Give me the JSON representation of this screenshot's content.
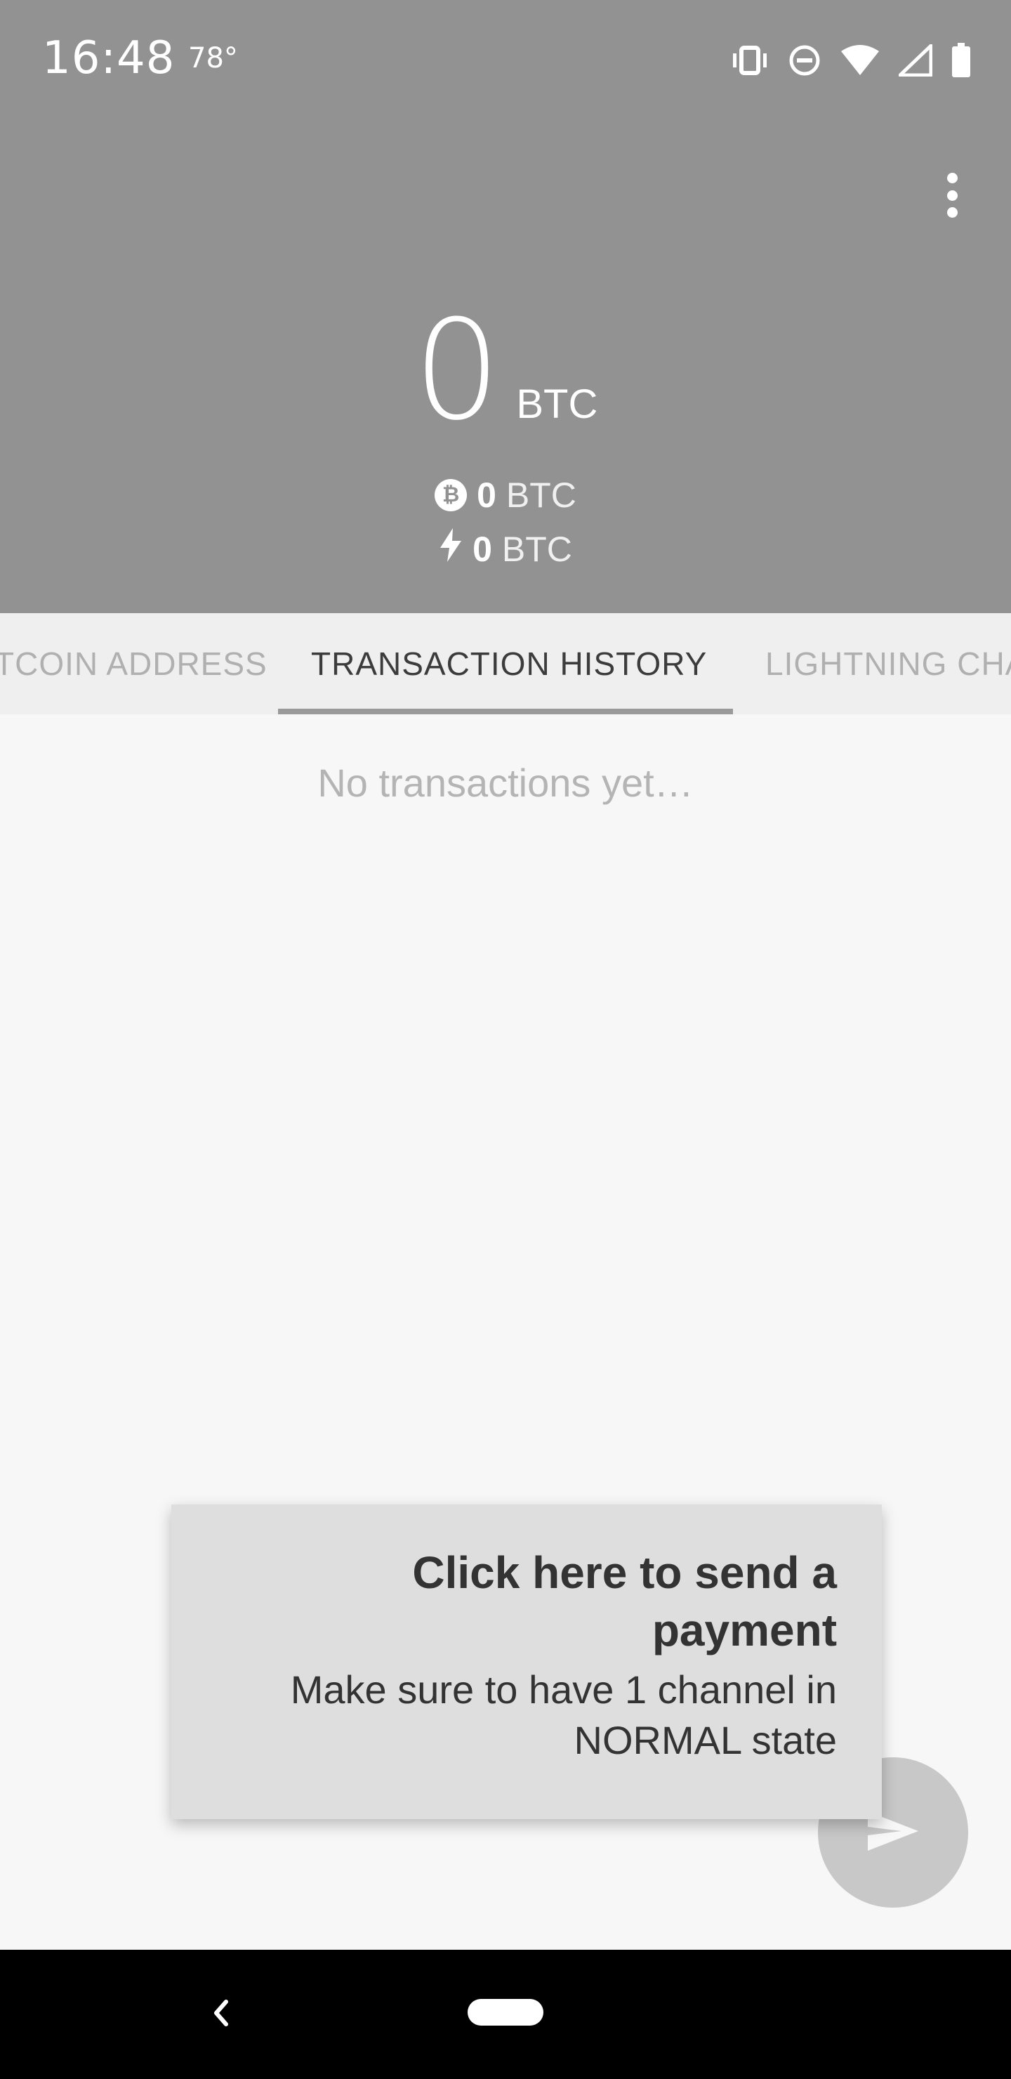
{
  "status_bar": {
    "time": "16:48",
    "temperature": "78°",
    "icons": [
      "vibrate-icon",
      "do-not-disturb-icon",
      "wifi-icon",
      "cell-signal-icon",
      "battery-icon"
    ]
  },
  "header": {
    "overflow_menu_icon": "more-vert-icon",
    "balance": {
      "amount": "0",
      "unit": "BTC"
    },
    "onchain_balance": {
      "icon": "bitcoin-icon",
      "amount": "0",
      "unit": "BTC"
    },
    "lightning_balance": {
      "icon": "lightning-icon",
      "amount": "0",
      "unit": "BTC"
    }
  },
  "tabs": [
    {
      "label": "TCOIN ADDRESS",
      "active": false
    },
    {
      "label": "TRANSACTION HISTORY",
      "active": true
    },
    {
      "label": "LIGHTNING CHA",
      "active": false
    }
  ],
  "content": {
    "empty_message": "No transactions yet…"
  },
  "tooltip": {
    "title": "Click here to send a payment",
    "body": "Make sure to have 1 channel in NORMAL state"
  },
  "fab": {
    "icon": "send-icon"
  },
  "nav_bar": {
    "back_icon": "back-icon",
    "home_icon": "home-pill-icon"
  },
  "colors": {
    "header_bg": "#929292",
    "tab_bar_bg": "#efefef",
    "content_bg": "#f7f7f7",
    "tooltip_bg": "#dedede",
    "fab_bg": "#c8c8c8"
  }
}
